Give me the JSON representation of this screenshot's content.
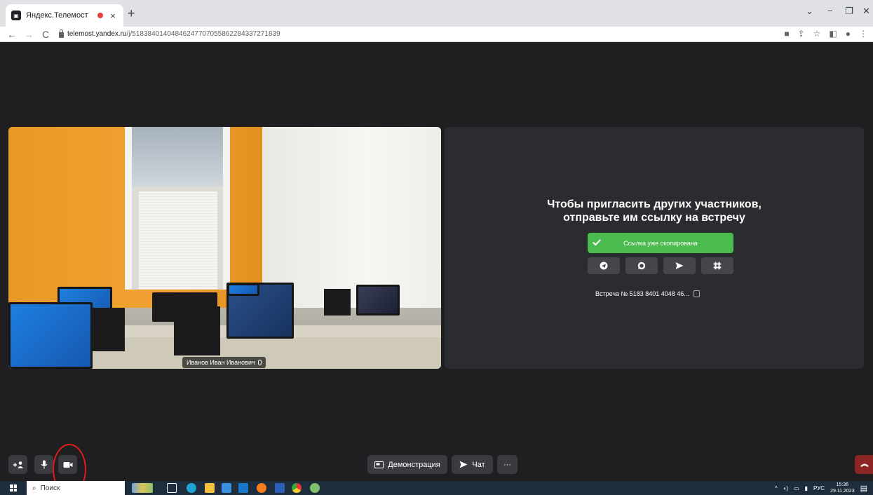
{
  "browser": {
    "tab_title": "Яндекс.Телемост",
    "url_host": "telemost.yandex.ru",
    "url_path": "/j/51838401404846247707055862284337271839"
  },
  "video": {
    "participant_name": "Иванов Иван Иванович"
  },
  "invite": {
    "title_line1": "Чтобы пригласить других участников,",
    "title_line2": "отправьте им ссылку на встречу",
    "copied_label": "Ссылка уже скопирована",
    "share_targets": [
      "telegram-icon",
      "whatsapp-icon",
      "send-icon",
      "slack-icon"
    ],
    "meeting_label": "Встреча № 5183 8401 4048 46..."
  },
  "toolbar": {
    "screenshare_label": "Демонстрация",
    "chat_label": "Чат",
    "more_label": "···"
  },
  "taskbar": {
    "search_placeholder": "Поиск",
    "lang": "РУС",
    "time": "15:36",
    "date": "29.11.2023"
  },
  "colors": {
    "app_bg": "#1f1f22",
    "panel_bg": "#2b2c30",
    "accent_green": "#4cbb4f",
    "end_call": "#8b2624",
    "highlight_ring": "#e21b1b"
  }
}
